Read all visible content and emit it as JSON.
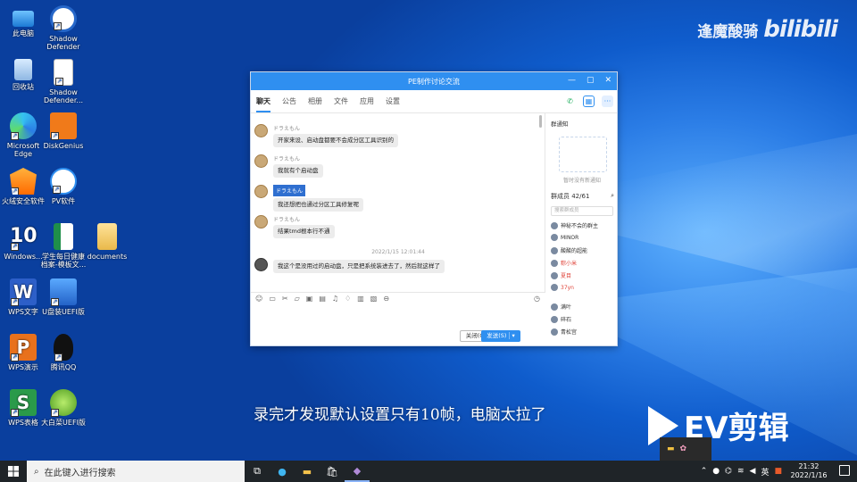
{
  "watermark": {
    "brand": "逢魔酸骑",
    "logo": "bilibili"
  },
  "desktop_icons": [
    {
      "label": "此电脑",
      "icon": "computer-icon"
    },
    {
      "label": "Shadow Defender",
      "icon": "shield-icon"
    },
    {
      "label": "回收站",
      "icon": "recycle-bin-icon"
    },
    {
      "label": "Shadow Defender...",
      "icon": "document-icon"
    },
    {
      "label": "Microsoft Edge",
      "icon": "edge-icon"
    },
    {
      "label": "DiskGenius",
      "icon": "diskgenius-icon"
    },
    {
      "label": "火绒安全软件",
      "icon": "huorong-icon"
    },
    {
      "label": "PV软件",
      "icon": "pv-icon"
    },
    {
      "label": "Windows...",
      "icon": "windows10-icon"
    },
    {
      "label": "学生每日健康档案-模板文...",
      "icon": "excel-icon"
    },
    {
      "label": "documents",
      "icon": "folder-icon"
    },
    {
      "label": "WPS文字",
      "icon": "wps-writer-icon"
    },
    {
      "label": "U盘装UEFI版",
      "icon": "usb-icon"
    },
    {
      "label": "WPS演示",
      "icon": "wps-presentation-icon"
    },
    {
      "label": "腾讯QQ",
      "icon": "qq-icon"
    },
    {
      "label": "WPS表格",
      "icon": "wps-spreadsheet-icon"
    },
    {
      "label": "大白菜UEFI版",
      "icon": "cabbage-icon"
    }
  ],
  "window": {
    "title": "PE制作讨论交流",
    "controls": [
      "—",
      "▢",
      "✕"
    ],
    "tabs": [
      "聊天",
      "公告",
      "相册",
      "文件",
      "应用",
      "设置"
    ],
    "messages": [
      {
        "name": "ドラえもん",
        "text": "开家来设、启动盘都要不会成分区工具识别的"
      },
      {
        "name": "ドラえもん",
        "text": "我就有个启动盘"
      },
      {
        "name": "ドラえもん",
        "text": "我还想把也通过分区工具修复呢"
      },
      {
        "name": "ドラえもん",
        "text": "结果tmd根本行不通"
      },
      {
        "name": "",
        "text": "我这个是没用过的启动盘，只是把系统装进去了，然后就这样了"
      }
    ],
    "timestamp": "2022/1/15 12:01:44",
    "close_button": "关闭(C)",
    "send_button": "发送(S)",
    "side": {
      "notice_title": "群通知",
      "notice_empty": "暂时没有新通知",
      "members_title": "群成员 42/61",
      "search_placeholder": "搜索群成员",
      "members": [
        "神秘不会的群主",
        "MINOR",
        "酸酸的超能",
        "粽小米",
        "夏目",
        "37yn",
        "满叶",
        "碎石",
        "青松宫"
      ]
    }
  },
  "subtitle": "录完才发现默认设置只有10帧，电脑太拉了",
  "ev_logo": "EV剪辑",
  "taskbar": {
    "search_placeholder": "在此键入进行搜索",
    "ime": "英",
    "time": "21:32",
    "date": "2022/1/16"
  }
}
